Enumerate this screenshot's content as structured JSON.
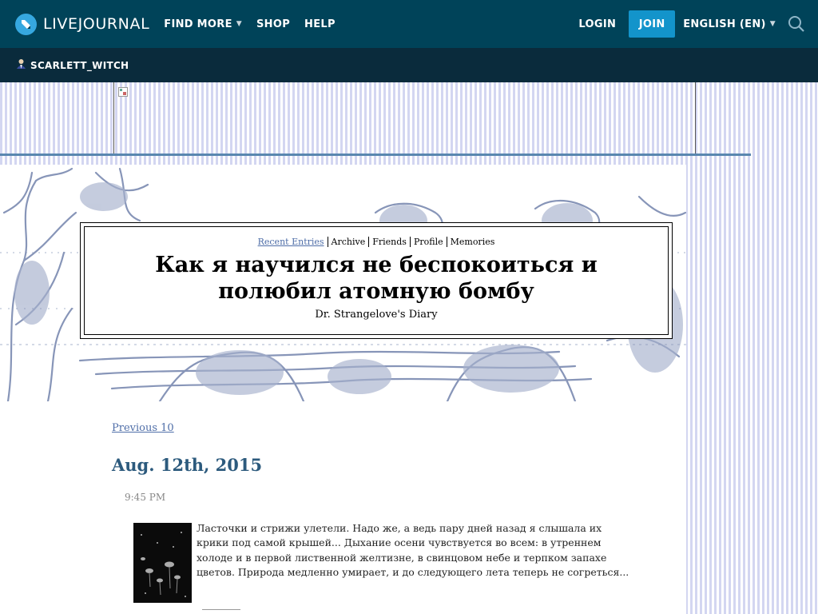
{
  "topnav": {
    "logo_text": "LIVEJOURNAL",
    "find_more": "FIND MORE",
    "shop": "SHOP",
    "help": "HELP",
    "login": "LOGIN",
    "join": "JOIN",
    "language": "ENGLISH (EN)"
  },
  "subbar": {
    "username": "SCARLETT_WITCH"
  },
  "journal": {
    "nav": {
      "recent": "Recent Entries",
      "archive": "Archive",
      "friends": "Friends",
      "profile": "Profile",
      "memories": "Memories"
    },
    "title": "Как я научился не беспокоиться и полюбил атомную бомбу",
    "subtitle": "Dr. Strangelove's Diary"
  },
  "entries": {
    "previous": "Previous 10",
    "date": "Aug. 12th, 2015",
    "time": "9:45 PM",
    "text": "Ласточки и стрижи улетели. Надо же, а ведь пару дней назад я слышала их крики под самой крышей... Дыхание осени чувствуется во всем: в утреннем холоде и в первой лиственной желтизне, в свинцовом небе и терпком запахе цветов. Природа медленно умирает, и до следующего лета теперь не согреться..."
  },
  "icons": {
    "logo": "livejournal-pencil-icon",
    "search": "search-icon",
    "user": "user-icon",
    "broken_image": "broken-image-icon"
  },
  "colors": {
    "topbar": "#004359",
    "subbar": "#0a2b3c",
    "join_button": "#1394cb",
    "link": "#4f6ea8",
    "date": "#2c5a7d",
    "stripe": "#d3d6f1",
    "illustration": "#8795b8"
  }
}
